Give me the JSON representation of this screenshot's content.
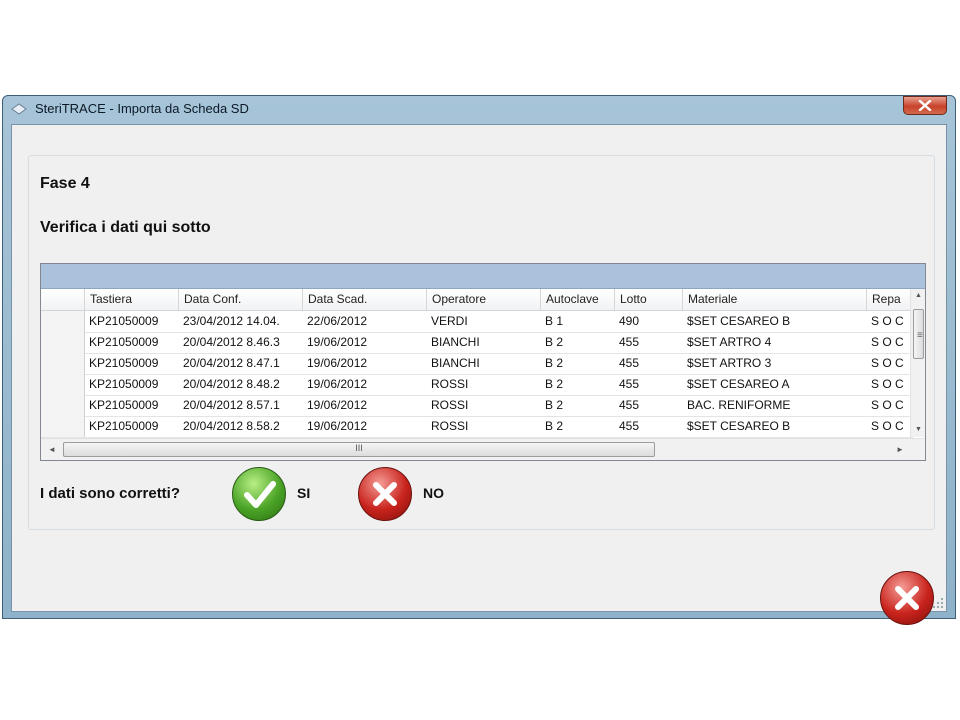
{
  "window": {
    "title": "SteriTRACE - Importa da Scheda SD"
  },
  "phase": {
    "label": "Fase 4",
    "instruction": "Verifica i dati qui sotto"
  },
  "grid": {
    "columns": [
      "Tastiera",
      "Data Conf.",
      "Data Scad.",
      "Operatore",
      "Autoclave",
      "Lotto",
      "Materiale",
      "Repa"
    ],
    "rows": [
      [
        "KP21050009",
        "23/04/2012 14.04.",
        "22/06/2012",
        "VERDI",
        "B 1",
        "490",
        "$SET CESAREO B",
        "S O C"
      ],
      [
        "KP21050009",
        "20/04/2012 8.46.3",
        "19/06/2012",
        "BIANCHI",
        "B 2",
        "455",
        "$SET ARTRO 4",
        "S O C"
      ],
      [
        "KP21050009",
        "20/04/2012 8.47.1",
        "19/06/2012",
        "BIANCHI",
        "B 2",
        "455",
        "$SET ARTRO 3",
        "S O C"
      ],
      [
        "KP21050009",
        "20/04/2012 8.48.2",
        "19/06/2012",
        "ROSSI",
        "B 2",
        "455",
        "$SET CESAREO A",
        "S O C"
      ],
      [
        "KP21050009",
        "20/04/2012 8.57.1",
        "19/06/2012",
        "ROSSI",
        "B 2",
        "455",
        "BAC. RENIFORME",
        "S O C"
      ],
      [
        "KP21050009",
        "20/04/2012 8.58.2",
        "19/06/2012",
        "ROSSI",
        "B 2",
        "455",
        "$SET CESAREO B",
        "S O C"
      ]
    ],
    "hscroll_grip": "III"
  },
  "confirm": {
    "question": "I dati sono corretti?",
    "yes_label": "SI",
    "no_label": "NO"
  },
  "icons": {
    "yes": "check-icon",
    "no": "x-icon",
    "exit": "x-icon",
    "window_close": "close-icon"
  },
  "colors": {
    "yes": "#4aa326",
    "no": "#c8231c",
    "grid_caption": "#abc2dd"
  }
}
